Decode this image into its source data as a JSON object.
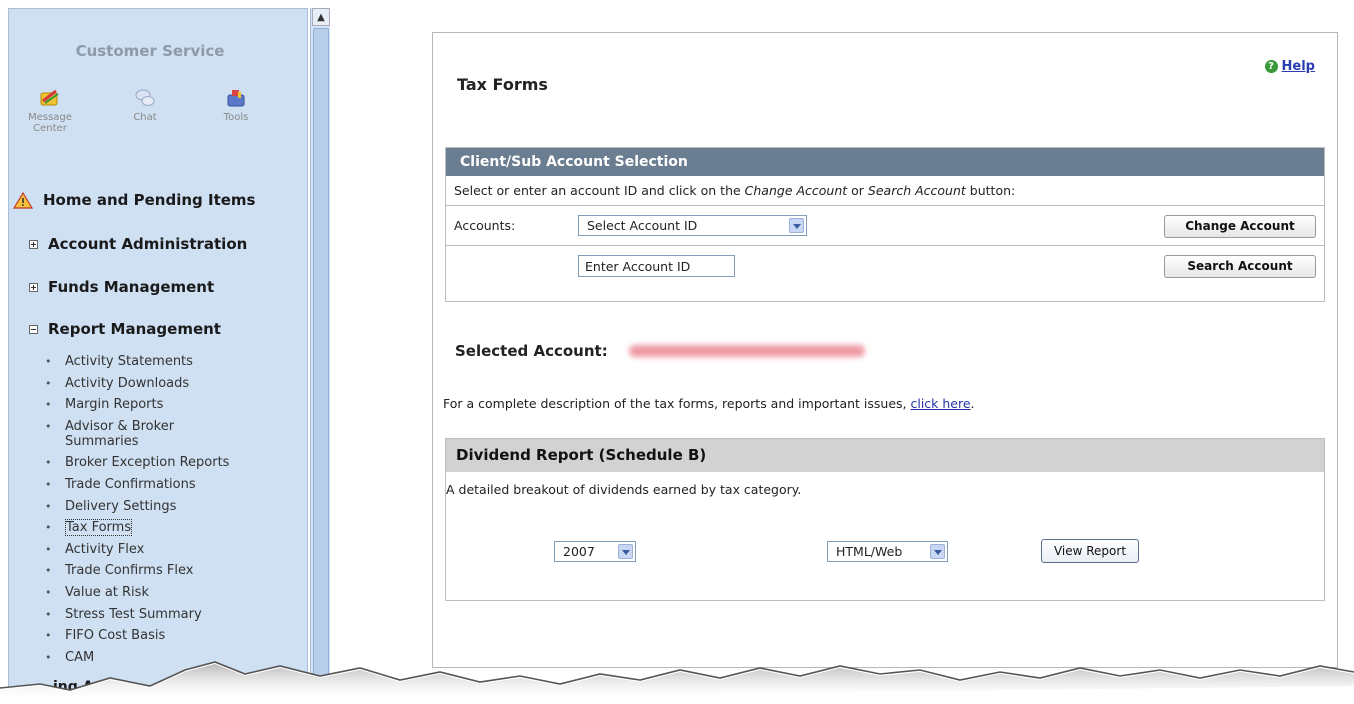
{
  "sidebar": {
    "title": "Customer Service",
    "tools": [
      {
        "label": "Message Center",
        "icon": "message-center-icon"
      },
      {
        "label": "Chat",
        "icon": "chat-icon"
      },
      {
        "label": "Tools",
        "icon": "tools-icon"
      }
    ],
    "sections": {
      "home": "Home and Pending Items",
      "account_admin": "Account Administration",
      "funds": "Funds Management",
      "report": "Report Management"
    },
    "report_items": [
      "Activity Statements",
      "Activity Downloads",
      "Margin Reports",
      "Advisor & Broker",
      "Summaries",
      "Broker Exception Reports",
      "Trade Confirmations",
      "Delivery Settings",
      "Tax Forms",
      "Activity Flex",
      "Trade Confirms Flex",
      "Value at Risk",
      "Stress Test Summary",
      "FIFO Cost Basis",
      "CAM"
    ],
    "cut_off_item": "ing A"
  },
  "main": {
    "title": "Tax Forms",
    "help_label": "Help",
    "client_section": {
      "header": "Client/Sub Account Selection",
      "instruction_prefix": "Select or enter an account ID and click on the ",
      "instruction_change": "Change Account",
      "instruction_or": " or ",
      "instruction_search": "Search Account",
      "instruction_suffix": " button:",
      "accounts_label": "Accounts:",
      "account_select_value": "Select Account ID",
      "account_id_input_value": "Enter Account ID",
      "change_button": "Change Account",
      "search_button": "Search Account"
    },
    "selected_account_label": "Selected Account:",
    "description_text": "For a complete description of the tax forms, reports and important issues, ",
    "description_link": "click here",
    "description_end": ".",
    "dividend_section": {
      "header": "Dividend Report (Schedule B)",
      "description": "A detailed breakout of dividends earned by tax category.",
      "year_value": "2007",
      "format_value": "HTML/Web",
      "view_button": "View Report"
    }
  },
  "colors": {
    "sidebar_bg": "#cfe0f3",
    "client_header_bg": "#6b7d90",
    "dividend_header_bg": "#d2d2d2",
    "link": "#2233aa"
  }
}
